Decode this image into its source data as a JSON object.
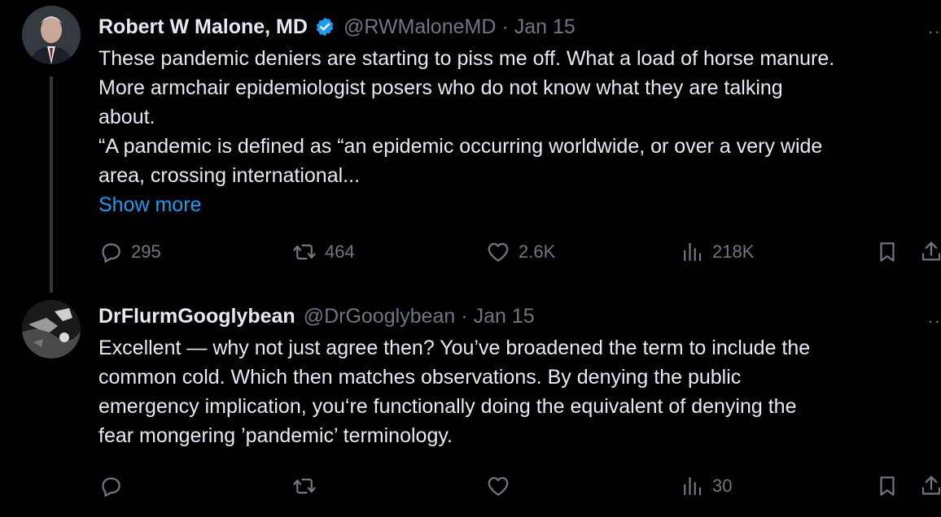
{
  "tweets": [
    {
      "display_name": "Robert W Malone, MD",
      "verified": true,
      "handle": "@RWMaloneMD",
      "separator": "·",
      "date": "Jan 15",
      "more": "··",
      "text_lines": [
        "These pandemic deniers are starting to piss me off.  What a load of horse manure.",
        "More armchair epidemiologist posers who do not know what they are talking",
        "about.",
        "“A pandemic is defined as “an epidemic occurring worldwide, or over a very wide",
        "area, crossing international..."
      ],
      "show_more": "Show more",
      "stats": {
        "replies": "295",
        "reposts": "464",
        "likes": "2.6K",
        "views": "218K"
      }
    },
    {
      "display_name": "DrFlurmGooglybean",
      "verified": false,
      "handle": "@DrGooglybean",
      "separator": "·",
      "date": "Jan 15",
      "more": "··",
      "text_lines": [
        "Excellent — why not just agree then?  You’ve broadened the term to include the",
        "common cold.  Which then matches observations.  By denying the public",
        "emergency implication, you‘re functionally doing the equivalent of denying the",
        "fear mongering ’pandemic’ terminology."
      ],
      "stats": {
        "replies": "",
        "reposts": "",
        "likes": "",
        "views": "30"
      }
    }
  ],
  "icons": {
    "reply": "reply-icon",
    "repost": "repost-icon",
    "like": "heart-icon",
    "views": "views-icon",
    "bookmark": "bookmark-icon",
    "share": "share-icon",
    "verified": "verified-badge-icon"
  },
  "colors": {
    "background": "#000000",
    "text": "#e7e9ea",
    "muted": "#71767b",
    "link": "#1d9bf0",
    "verified": "#1d9bf0",
    "thread_line": "#333639"
  }
}
